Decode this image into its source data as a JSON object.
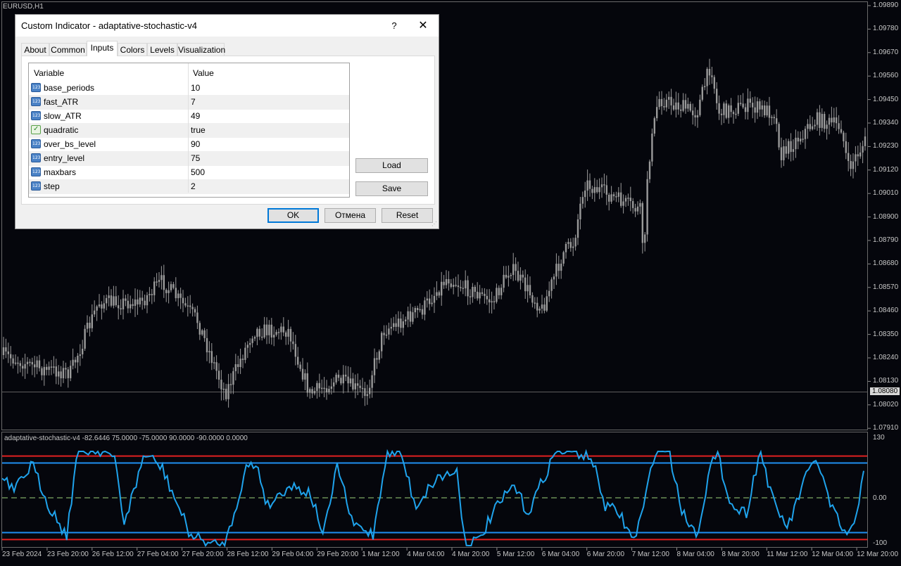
{
  "chart": {
    "symbol": "EURUSD,H1",
    "price_labels": [
      "1.09890",
      "1.09780",
      "1.09670",
      "1.09560",
      "1.09450",
      "1.09340",
      "1.09230",
      "1.09120",
      "1.09010",
      "1.08900",
      "1.08790",
      "1.08680",
      "1.08570",
      "1.08460",
      "1.08350",
      "1.08240",
      "1.08130",
      "1.08020",
      "1.07910"
    ],
    "current_price": "1.08080",
    "indicator_title": "adaptative-stochastic-v4 -82.6446 75.0000 -75.0000 90.0000 -90.0000 0.0000",
    "indicator_levels": [
      "130",
      "0.00",
      "-100"
    ],
    "time_labels": [
      "23 Feb 2024",
      "23 Feb 20:00",
      "26 Feb 12:00",
      "27 Feb 04:00",
      "27 Feb 20:00",
      "28 Feb 12:00",
      "29 Feb 04:00",
      "29 Feb 20:00",
      "1 Mar 12:00",
      "4 Mar 04:00",
      "4 Mar 20:00",
      "5 Mar 12:00",
      "6 Mar 04:00",
      "6 Mar 20:00",
      "7 Mar 12:00",
      "8 Mar 04:00",
      "8 Mar 20:00",
      "11 Mar 12:00",
      "12 Mar 04:00",
      "12 Mar 20:00"
    ],
    "colors": {
      "background": "#05060c",
      "candles": "#9a9a9a",
      "stoch_line": "#1fa3ec",
      "over_bs_level": "#e02020",
      "entry_level": "#1f8ff0",
      "zero_level": "#9ad27a"
    }
  },
  "dialog": {
    "title": "Custom Indicator - adaptative-stochastic-v4",
    "help": "?",
    "close": "✕",
    "tabs": [
      "About",
      "Common",
      "Inputs",
      "Colors",
      "Levels",
      "Visualization"
    ],
    "active_tab": "Inputs",
    "columns": {
      "variable": "Variable",
      "value": "Value"
    },
    "params": [
      {
        "name": "base_periods",
        "value": "10",
        "type": "int"
      },
      {
        "name": "fast_ATR",
        "value": "7",
        "type": "int"
      },
      {
        "name": "slow_ATR",
        "value": "49",
        "type": "int"
      },
      {
        "name": "quadratic",
        "value": "true",
        "type": "bool"
      },
      {
        "name": "over_bs_level",
        "value": "90",
        "type": "int"
      },
      {
        "name": "entry_level",
        "value": "75",
        "type": "int"
      },
      {
        "name": "maxbars",
        "value": "500",
        "type": "int"
      },
      {
        "name": "step",
        "value": "2",
        "type": "int"
      }
    ],
    "buttons": {
      "load": "Load",
      "save": "Save",
      "ok": "OK",
      "cancel": "Отмена",
      "reset": "Reset"
    }
  }
}
